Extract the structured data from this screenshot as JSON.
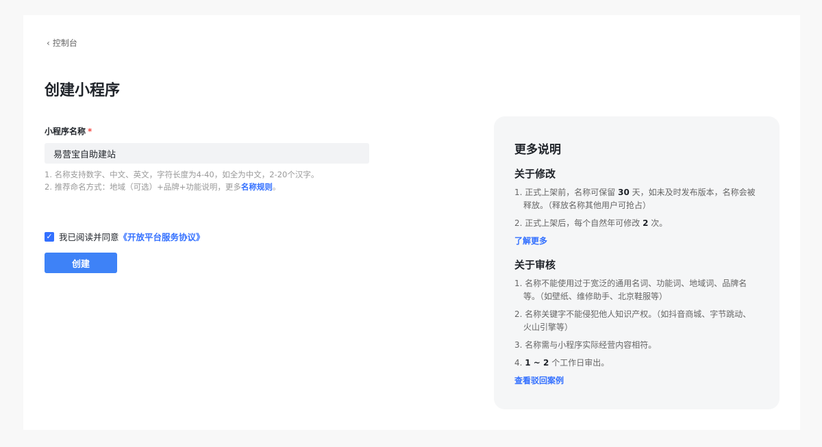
{
  "nav": {
    "back_label": "控制台"
  },
  "page": {
    "title": "创建小程序"
  },
  "form": {
    "name_label": "小程序名称",
    "required_mark": "*",
    "name_value": "易营宝自助建站",
    "hint1": "1. 名称支持数字、中文、英文，字符长度为4-40，如全为中文，2-20个汉字。",
    "hint2_prefix": "2. 推荐命名方式：地域（可选）+品牌+功能说明，更多",
    "hint2_link": "名称规则",
    "hint2_suffix": "。",
    "agree_prefix": "我已阅读并同意",
    "agree_link": "《开放平台服务协议》",
    "agree_checked": true,
    "submit_label": "创建"
  },
  "panel": {
    "title": "更多说明",
    "modify": {
      "heading": "关于修改",
      "item1": {
        "a": "1. 正式上架前，名称可保留 ",
        "b": "30",
        "c": " 天，如未及时发布版本，名称会被释放。（释放名称其他用户可抢占）"
      },
      "item2": {
        "a": "2. 正式上架后，每个自然年可修改 ",
        "b": "2",
        "c": " 次。"
      },
      "link": "了解更多"
    },
    "review": {
      "heading": "关于审核",
      "item1": "1. 名称不能使用过于宽泛的通用名词、功能词、地域词、品牌名等。（如壁纸、维修助手、北京鞋服等）",
      "item2": "2. 名称关键字不能侵犯他人知识产权。（如抖音商城、字节跳动、火山引擎等）",
      "item3": "3. 名称需与小程序实际经营内容相符。",
      "item4": {
        "a": "4. ",
        "b": "1 ~ 2",
        "c": " 个工作日审出。"
      },
      "link": "查看驳回案例"
    }
  }
}
